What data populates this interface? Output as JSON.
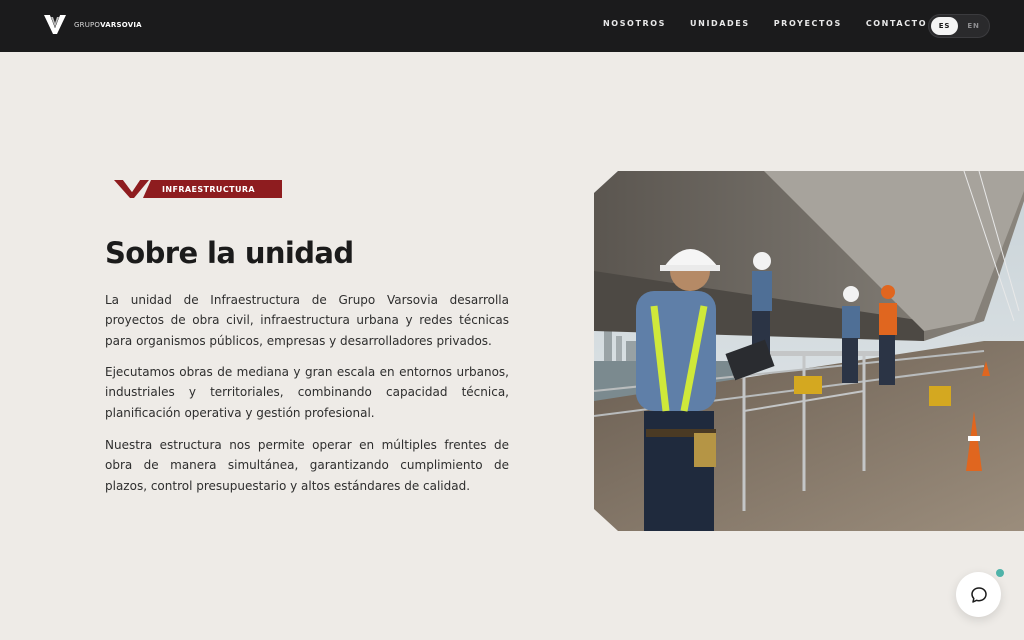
{
  "header": {
    "logo": {
      "prefix": "GRUPO",
      "brand": "VARSOVIA"
    },
    "nav": [
      "NOSOTROS",
      "UNIDADES",
      "PROYECTOS",
      "CONTACTO"
    ],
    "lang": {
      "active": "ES",
      "inactive": "EN"
    }
  },
  "section": {
    "badge": "INFRAESTRUCTURA",
    "title": "Sobre la unidad",
    "paragraphs": [
      "La unidad de Infraestructura de Grupo Varsovia desarrolla proyectos de obra civil, infraestructura urbana y redes técnicas para organismos públicos, empresas y desarrolladores privados.",
      "Ejecutamos obras de mediana y gran escala en entornos urbanos, industriales y territoriales, combinando capacidad técnica, planificación operativa y gestión profesional.",
      "Nuestra estructura nos permite operar en múltiples frentes de obra de manera simultánea, garantizando cumplimiento de plazos, control presupuestario y altos estándares de calidad."
    ]
  },
  "colors": {
    "header_bg": "#1b1b1c",
    "page_bg": "#eeebe7",
    "brand_red": "#8e1c1f",
    "chat_dot": "#4fb3a9"
  },
  "icons": {
    "chat": "chat-bubble-icon",
    "logo": "varsovia-v-logo"
  }
}
